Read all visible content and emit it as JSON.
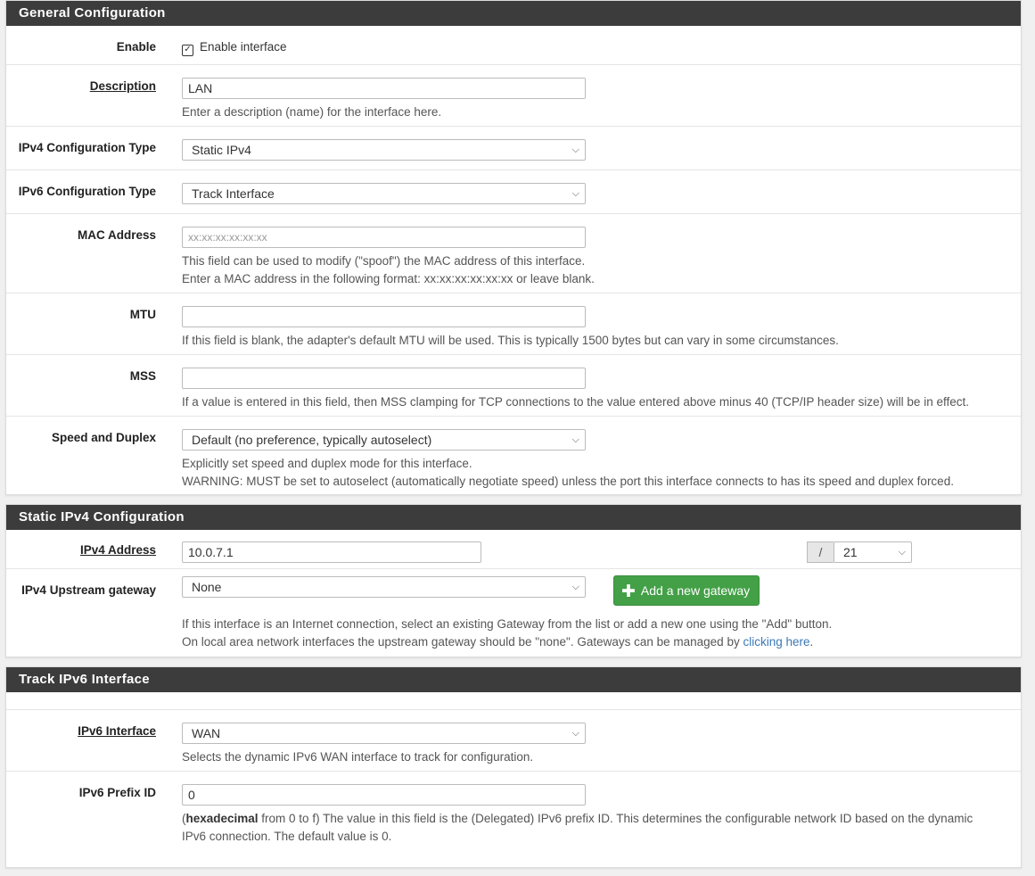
{
  "general": {
    "title": "General Configuration",
    "enable_label": "Enable",
    "enable_check_label": "Enable interface",
    "enable_checked_glyph": "☒",
    "description_label": "Description",
    "description_value": "LAN",
    "description_help": "Enter a description (name) for the interface here.",
    "ipv4_type_label": "IPv4 Configuration Type",
    "ipv4_type_value": "Static IPv4",
    "ipv6_type_label": "IPv6 Configuration Type",
    "ipv6_type_value": "Track Interface",
    "mac_label": "MAC Address",
    "mac_placeholder": "xx:xx:xx:xx:xx:xx",
    "mac_help1": "This field can be used to modify (\"spoof\") the MAC address of this interface.",
    "mac_help2": "Enter a MAC address in the following format: xx:xx:xx:xx:xx:xx or leave blank.",
    "mtu_label": "MTU",
    "mtu_help": "If this field is blank, the adapter's default MTU will be used. This is typically 1500 bytes but can vary in some circumstances.",
    "mss_label": "MSS",
    "mss_help": "If a value is entered in this field, then MSS clamping for TCP connections to the value entered above minus 40 (TCP/IP header size) will be in effect.",
    "speed_label": "Speed and Duplex",
    "speed_value": "Default (no preference, typically autoselect)",
    "speed_help1": "Explicitly set speed and duplex mode for this interface.",
    "speed_help2": "WARNING: MUST be set to autoselect (automatically negotiate speed) unless the port this interface connects to has its speed and duplex forced."
  },
  "static_ipv4": {
    "title": "Static IPv4 Configuration",
    "address_label": "IPv4 Address",
    "address_value": "10.0.7.1",
    "slash": "/",
    "cidr_value": "21",
    "gateway_label": "IPv4 Upstream gateway",
    "gateway_value": "None",
    "add_gateway_button": "Add a new gateway",
    "help1": "If this interface is an Internet connection, select an existing Gateway from the list or add a new one using the \"Add\" button.",
    "help2_prefix": "On local area network interfaces the upstream gateway should be \"none\". Gateways can be managed by ",
    "help2_link": "clicking here",
    "help2_suffix": "."
  },
  "track_ipv6": {
    "title": "Track IPv6 Interface",
    "interface_label": "IPv6 Interface",
    "interface_value": "WAN",
    "interface_help": "Selects the dynamic IPv6 WAN interface to track for configuration.",
    "prefix_label": "IPv6 Prefix ID",
    "prefix_value": "0",
    "prefix_help_bold": "hexadecimal",
    "prefix_help_rest": " from 0 to f) The value in this field is the (Delegated) IPv6 prefix ID. This determines the configurable network ID based on the dynamic",
    "prefix_help_line2": "IPv6 connection. The default value is 0.",
    "open_paren": "("
  },
  "icons": {
    "chevron": "⌄",
    "plus": "✚"
  }
}
